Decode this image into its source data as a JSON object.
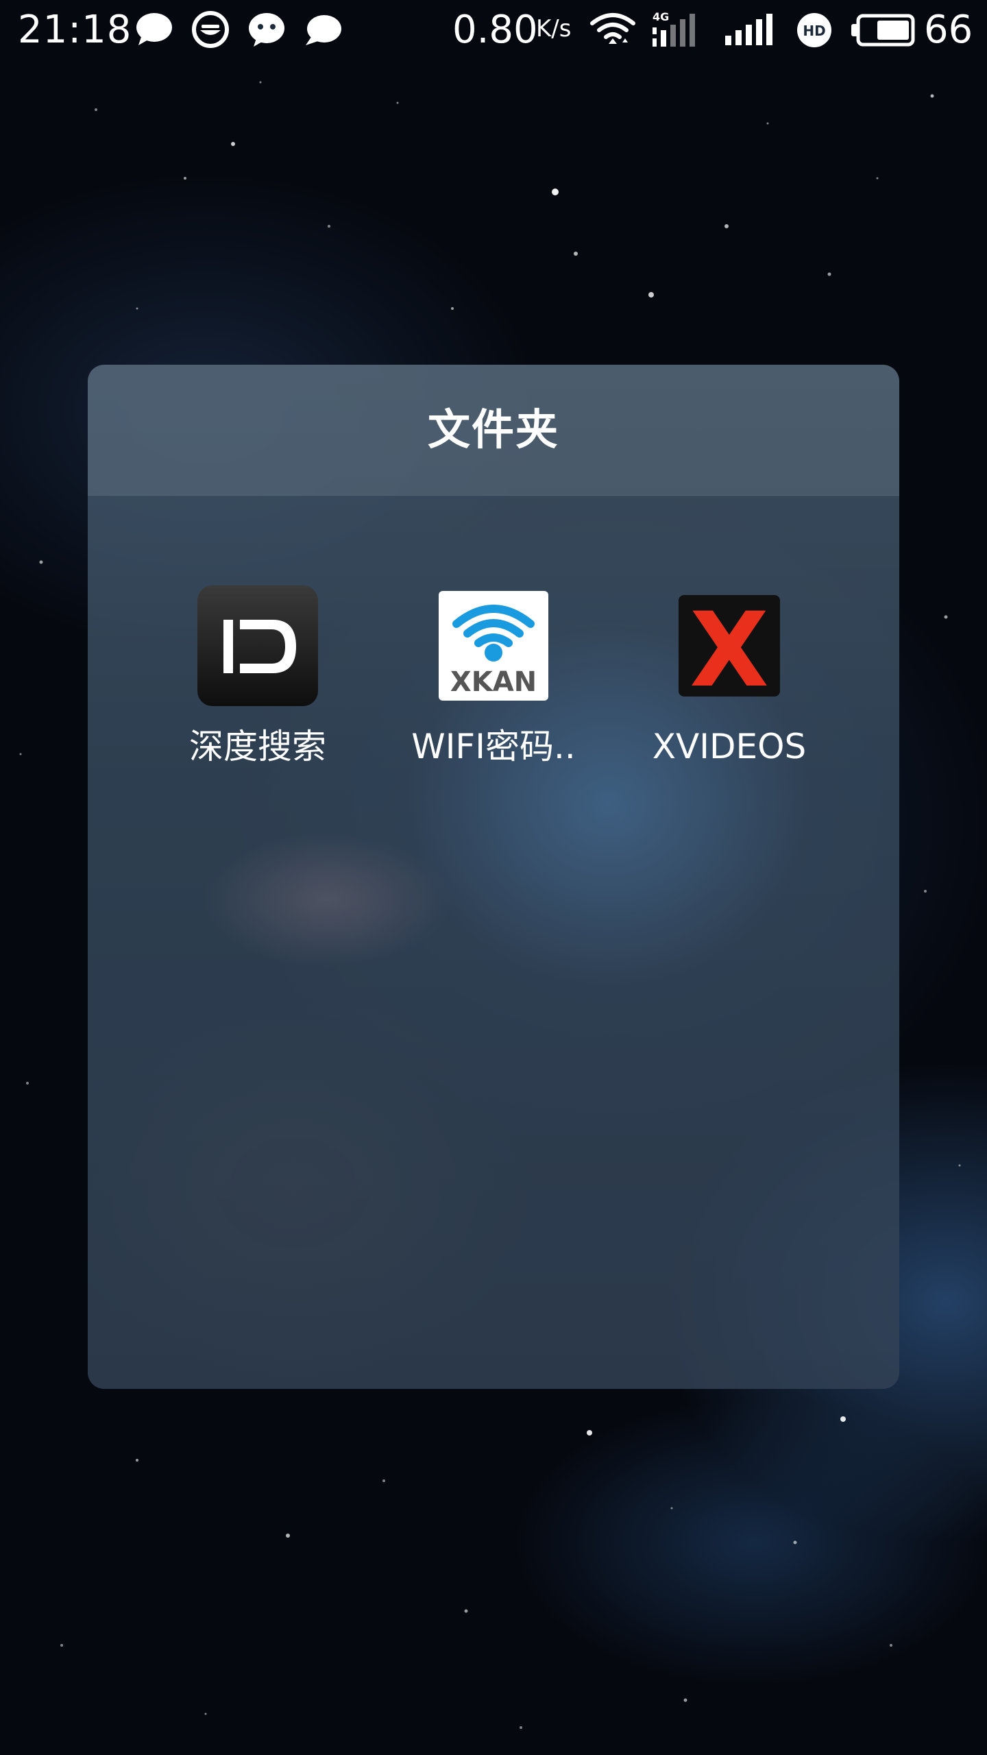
{
  "status_bar": {
    "time": "21:18",
    "notification_icons": [
      "chat-bubble-icon",
      "qq-browser-icon",
      "wechat-icon",
      "message-icon"
    ],
    "net_speed": "0.80",
    "net_speed_unit": "K/s",
    "network_type": "4G",
    "battery_level": "66"
  },
  "folder": {
    "title": "文件夹",
    "apps": [
      {
        "label": "深度搜索",
        "icon": "deep-search-app-icon"
      },
      {
        "label": "WIFI密码..",
        "icon": "xkan-wifi-app-icon",
        "icon_text": "XKAN"
      },
      {
        "label": "XVIDEOS",
        "icon": "xvideos-app-icon",
        "icon_text": "X"
      }
    ]
  },
  "colors": {
    "wifi_blue": "#1a9be0",
    "x_red": "#e8301c",
    "xkan_gray": "#555555"
  }
}
